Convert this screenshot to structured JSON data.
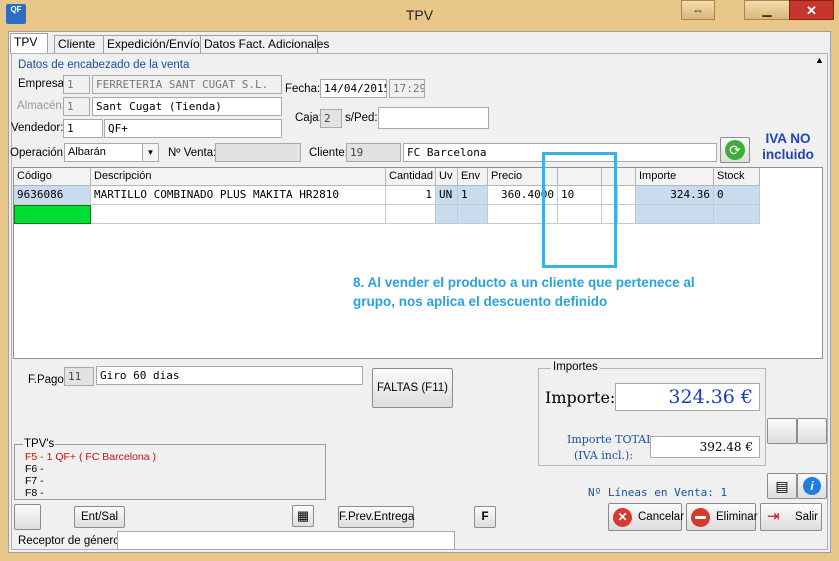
{
  "window": {
    "title": "TPV",
    "logo": "QF",
    "close": "✕",
    "swap_icon": "⇔",
    "minimize": "▁"
  },
  "tabs": [
    {
      "label": "TPV"
    },
    {
      "label": "Cliente"
    },
    {
      "label": "Expedición/Envío"
    },
    {
      "label": "Datos Fact. Adicionales"
    }
  ],
  "header": {
    "section_title": "Datos de encabezado de la venta",
    "empresa": {
      "label": "Empresa:",
      "code": "1",
      "name": "FERRETERIA SANT CUGAT S.L."
    },
    "almacen": {
      "label": "Almacén:",
      "code": "1",
      "name": "Sant Cugat (Tienda)"
    },
    "vendedor": {
      "label": "Vendedor:",
      "code": "1",
      "name": "QF+"
    },
    "fecha": {
      "label": "Fecha:",
      "date": "14/04/2015",
      "time": "17:29"
    },
    "caja": {
      "label": "Caja:",
      "value": "2"
    },
    "sped": {
      "label": "s/Ped:",
      "value": ""
    },
    "operacion": {
      "label": "Operación:",
      "value": "Albarán"
    },
    "num_venta": {
      "label": "Nº Venta:",
      "value": ""
    },
    "cliente": {
      "label": "Cliente:",
      "code": "19",
      "name": "FC Barcelona"
    },
    "iva_note": [
      "IVA NO",
      "incluido"
    ]
  },
  "grid": {
    "columns": [
      "Código",
      "Descripción",
      "Cantidad",
      "Uv",
      "Env",
      "Precio",
      "",
      "",
      "",
      "Importe",
      "Stock"
    ],
    "rows": [
      [
        "9636086",
        "MARTILLO COMBINADO PLUS MAKITA HR2810",
        "1",
        "UN",
        "1",
        "360.4000",
        "10",
        "",
        "",
        "324.36",
        "0"
      ]
    ]
  },
  "annotation": "8. Al vender el producto a un cliente que pertenece al grupo, nos aplica el descuento definido",
  "payment": {
    "label": "F.Pago",
    "code": "11",
    "name": "Giro 60 dias"
  },
  "faltas_button": "FALTAS (F11)",
  "importes": {
    "title": "Importes",
    "importe_label": "Importe:",
    "importe_value": "324.36 €",
    "total_label_1": "Importe TOTAL",
    "total_label_2": "(IVA incl.):",
    "total_value": "392.48 €"
  },
  "lineas": "Nº Líneas en Venta: 1",
  "tpvs": {
    "title": "TPV's",
    "items": [
      "F5 - 1 QF+ ( FC Barcelona )",
      "F6 -",
      "F7 -",
      "F8 -"
    ]
  },
  "buttons": {
    "ent_sal": "Ent/Sal",
    "prev_entrega": "F.Prev.Entrega",
    "f": "F",
    "cancelar": "Cancelar",
    "eliminar": "Eliminar",
    "salir": "Salir"
  },
  "receptor": {
    "label": "Receptor de género",
    "value": ""
  },
  "colors": {
    "accent": "#1d4fa0",
    "selection": "#00dd33",
    "annotation": "#3db1e5",
    "frame": "#e9c78b"
  }
}
